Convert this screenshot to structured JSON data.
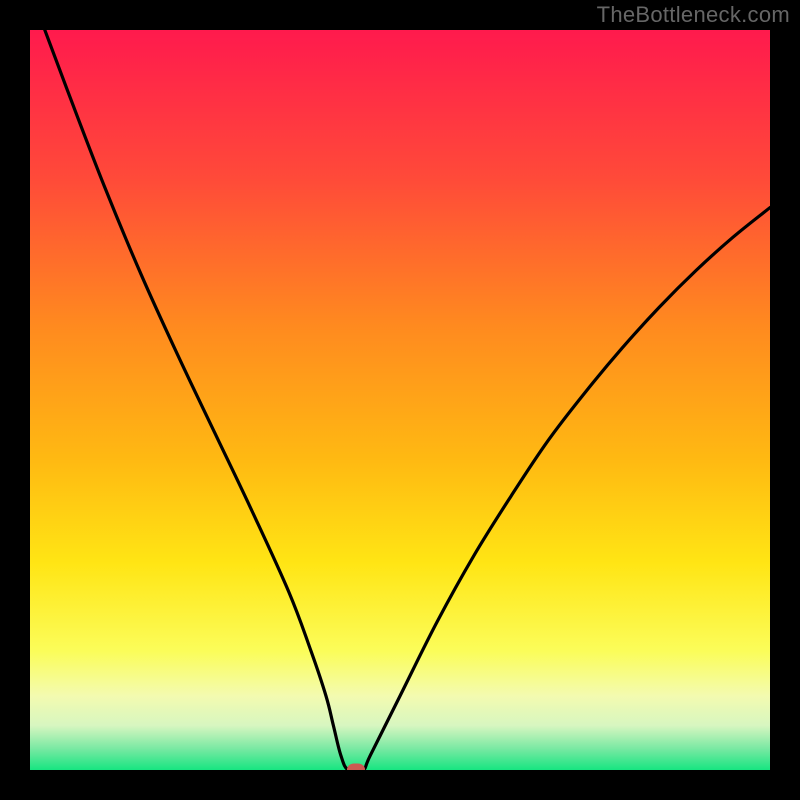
{
  "watermark": "TheBottleneck.com",
  "chart_data": {
    "type": "line",
    "title": "",
    "xlabel": "",
    "ylabel": "",
    "xlim": [
      0,
      100
    ],
    "ylim": [
      0,
      100
    ],
    "series": [
      {
        "name": "bottleneck-curve",
        "x": [
          2,
          5,
          10,
          15,
          20,
          25,
          30,
          35,
          38,
          40,
          41,
          42,
          43,
          45,
          46,
          50,
          55,
          60,
          65,
          70,
          75,
          80,
          85,
          90,
          95,
          100
        ],
        "y": [
          100,
          92,
          79,
          67,
          56,
          45.5,
          35,
          24,
          16,
          10,
          6,
          2,
          0,
          0,
          2,
          10,
          20,
          29,
          37,
          44.5,
          51,
          57,
          62.5,
          67.5,
          72,
          76
        ]
      }
    ],
    "marker": {
      "x": 44,
      "y": 0
    },
    "gradient_stops": [
      {
        "offset": 0,
        "color": "#ff1a4d"
      },
      {
        "offset": 20,
        "color": "#ff4a39"
      },
      {
        "offset": 40,
        "color": "#ff8a1f"
      },
      {
        "offset": 58,
        "color": "#ffb912"
      },
      {
        "offset": 72,
        "color": "#ffe514"
      },
      {
        "offset": 84,
        "color": "#fbfd5a"
      },
      {
        "offset": 90,
        "color": "#f3fbb0"
      },
      {
        "offset": 94,
        "color": "#d7f6c0"
      },
      {
        "offset": 97,
        "color": "#7de9a4"
      },
      {
        "offset": 100,
        "color": "#17e581"
      }
    ]
  }
}
